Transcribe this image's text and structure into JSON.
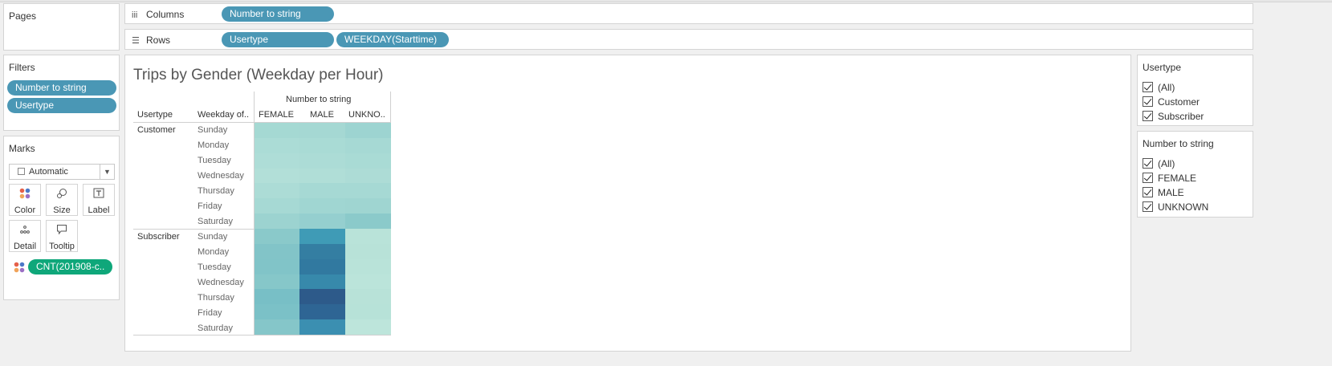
{
  "pages_panel": {
    "title": "Pages"
  },
  "columns_shelf": {
    "label": "Columns",
    "pills": [
      "Number to string"
    ]
  },
  "rows_shelf": {
    "label": "Rows",
    "pills": [
      "Usertype",
      "WEEKDAY(Starttime)"
    ]
  },
  "filters_panel": {
    "title": "Filters",
    "pills": [
      "Number to string",
      "Usertype"
    ]
  },
  "marks_panel": {
    "title": "Marks",
    "mark_type": "Automatic",
    "buttons": [
      {
        "label": "Color",
        "icon": "color-dots-icon"
      },
      {
        "label": "Size",
        "icon": "size-icon"
      },
      {
        "label": "Label",
        "icon": "label-icon"
      },
      {
        "label": "Detail",
        "icon": "detail-icon"
      },
      {
        "label": "Tooltip",
        "icon": "tooltip-icon"
      }
    ],
    "color_pill": "CNT(201908-c.."
  },
  "viz": {
    "title": "Trips by Gender (Weekday per Hour)",
    "column_field": "Number to string",
    "row_header_1": "Usertype",
    "row_header_2": "Weekday of..",
    "columns": [
      "FEMALE",
      "MALE",
      "UNKNO.."
    ],
    "groups": [
      {
        "name": "Customer",
        "days": [
          "Sunday",
          "Monday",
          "Tuesday",
          "Wednesday",
          "Thursday",
          "Friday",
          "Saturday"
        ]
      },
      {
        "name": "Subscriber",
        "days": [
          "Sunday",
          "Monday",
          "Tuesday",
          "Wednesday",
          "Thursday",
          "Friday",
          "Saturday"
        ]
      }
    ],
    "cell_colors": [
      [
        "#a5d9d3",
        "#a5d8d3",
        "#9dd4d1"
      ],
      [
        "#abdcd6",
        "#a9dbd5",
        "#a6d9d4"
      ],
      [
        "#aeddd7",
        "#acdcd6",
        "#a9dbd5"
      ],
      [
        "#b2dfd8",
        "#b0ded7",
        "#addcd6"
      ],
      [
        "#acdcd6",
        "#a6d9d4",
        "#a6d9d4"
      ],
      [
        "#a6d9d4",
        "#a0d6d2",
        "#9fd5d1"
      ],
      [
        "#9cd3d0",
        "#95cfcf",
        "#8bcaca"
      ],
      [
        "#8ac9ca",
        "#3f9bb6",
        "#b9e3d9"
      ],
      [
        "#82c4c8",
        "#347ea2",
        "#b8e2d8"
      ],
      [
        "#81c4c8",
        "#3179a0",
        "#b9e3d9"
      ],
      [
        "#86c7c9",
        "#3789ab",
        "#bbe4da"
      ],
      [
        "#78bfc6",
        "#2d5a8a",
        "#b8e2d8"
      ],
      [
        "#7bc1c7",
        "#2e6594",
        "#b7e2d8"
      ],
      [
        "#85c6c9",
        "#3b8fb1",
        "#bde5db"
      ]
    ]
  },
  "usertype_filter": {
    "title": "Usertype",
    "items": [
      "(All)",
      "Customer",
      "Subscriber"
    ]
  },
  "number_filter": {
    "title": "Number to string",
    "items": [
      "(All)",
      "FEMALE",
      "MALE",
      "UNKNOWN"
    ]
  }
}
